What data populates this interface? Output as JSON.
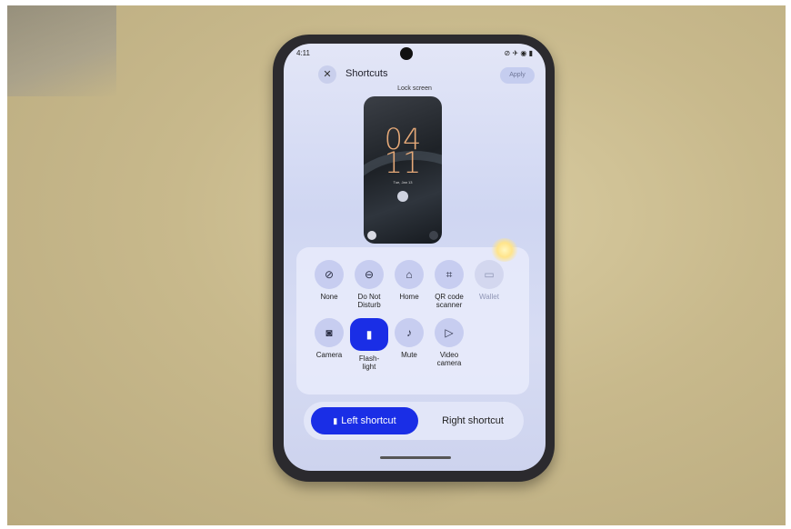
{
  "status_bar": {
    "time": "4:11",
    "icons_text": "⊘ ✈ ◉ ▮"
  },
  "header": {
    "title": "Shortcuts",
    "close_icon": "close-icon",
    "apply_label": "Apply"
  },
  "preview": {
    "label": "Lock screen",
    "clock_hours": "04",
    "clock_minutes": "11",
    "date": "Tue, Jan 13"
  },
  "shortcut_options": [
    {
      "label": "None",
      "icon": "none-icon",
      "glyph": "⊘"
    },
    {
      "label": "Do Not\nDisturb",
      "icon": "do-not-disturb-icon",
      "glyph": "⊖"
    },
    {
      "label": "Home",
      "icon": "home-icon",
      "glyph": "⌂"
    },
    {
      "label": "QR code\nscanner",
      "icon": "qr-code-icon",
      "glyph": "⌗"
    },
    {
      "label": "Wallet",
      "icon": "wallet-icon",
      "glyph": "▭",
      "disabled": true
    },
    {
      "label": "Camera",
      "icon": "camera-icon",
      "glyph": "◙"
    },
    {
      "label": "Flash-\nlight",
      "icon": "flashlight-icon",
      "glyph": "▮",
      "selected": true
    },
    {
      "label": "Mute",
      "icon": "mute-icon",
      "glyph": "♪"
    },
    {
      "label": "Video\ncamera",
      "icon": "video-camera-icon",
      "glyph": "▷"
    }
  ],
  "segmented": {
    "left_label": "Left shortcut",
    "right_label": "Right shortcut",
    "active": "left"
  },
  "colors": {
    "accent": "#1a2ee6",
    "tile": "#c7cdf0",
    "screen_bg": "#d7dcf3",
    "clock": "#e6a978"
  }
}
